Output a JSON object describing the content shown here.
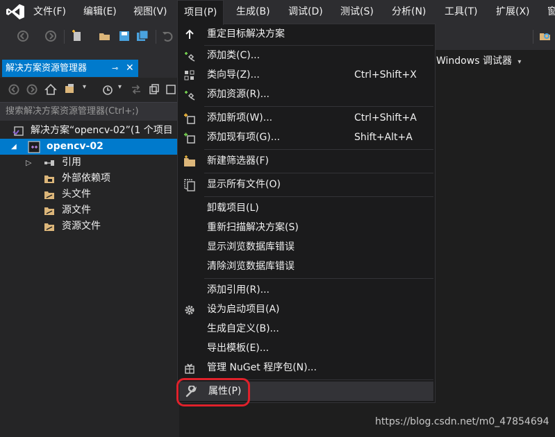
{
  "menubar": {
    "items": [
      {
        "label": "文件(F)"
      },
      {
        "label": "编辑(E)"
      },
      {
        "label": "视图(V)"
      },
      {
        "label": "项目(P)"
      },
      {
        "label": "生成(B)"
      },
      {
        "label": "调试(D)"
      },
      {
        "label": "测试(S)"
      },
      {
        "label": "分析(N)"
      },
      {
        "label": "工具(T)"
      },
      {
        "label": "扩展(X)"
      },
      {
        "label": "窗"
      }
    ]
  },
  "toolbar": {
    "debugger_label": "Windows 调试器"
  },
  "solution_explorer": {
    "tab_title": "解决方案资源管理器",
    "pin_glyph": "⊸",
    "close_glyph": "✕",
    "search_placeholder": "搜索解决方案资源管理器(Ctrl+;)",
    "tree": [
      {
        "label": "解决方案“opencv-02”(1 个项目"
      },
      {
        "label": "opencv-02"
      },
      {
        "label": "引用"
      },
      {
        "label": "外部依赖项"
      },
      {
        "label": "头文件"
      },
      {
        "label": "源文件"
      },
      {
        "label": "资源文件"
      }
    ]
  },
  "project_menu": {
    "items": [
      {
        "label": "重定目标解决方案",
        "shortcut": ""
      },
      {
        "label": "添加类(C)...",
        "shortcut": ""
      },
      {
        "label": "类向导(Z)...",
        "shortcut": "Ctrl+Shift+X"
      },
      {
        "label": "添加资源(R)...",
        "shortcut": ""
      },
      {
        "label": "添加新项(W)...",
        "shortcut": "Ctrl+Shift+A"
      },
      {
        "label": "添加现有项(G)...",
        "shortcut": "Shift+Alt+A"
      },
      {
        "label": "新建筛选器(F)",
        "shortcut": ""
      },
      {
        "label": "显示所有文件(O)",
        "shortcut": ""
      },
      {
        "label": "卸载项目(L)",
        "shortcut": ""
      },
      {
        "label": "重新扫描解决方案(S)",
        "shortcut": ""
      },
      {
        "label": "显示浏览数据库错误",
        "shortcut": ""
      },
      {
        "label": "清除浏览数据库错误",
        "shortcut": ""
      },
      {
        "label": "添加引用(R)...",
        "shortcut": ""
      },
      {
        "label": "设为启动项目(A)",
        "shortcut": ""
      },
      {
        "label": "生成自定义(B)...",
        "shortcut": ""
      },
      {
        "label": "导出模板(E)...",
        "shortcut": ""
      },
      {
        "label": "管理 NuGet 程序包(N)...",
        "shortcut": ""
      },
      {
        "label": "属性(P)",
        "shortcut": ""
      }
    ]
  },
  "watermark": "https://blog.csdn.net/m0_47854694",
  "colors": {
    "accent": "#007acc",
    "menu_bg": "#1b1b1c",
    "highlight_ring": "#e0212b"
  }
}
